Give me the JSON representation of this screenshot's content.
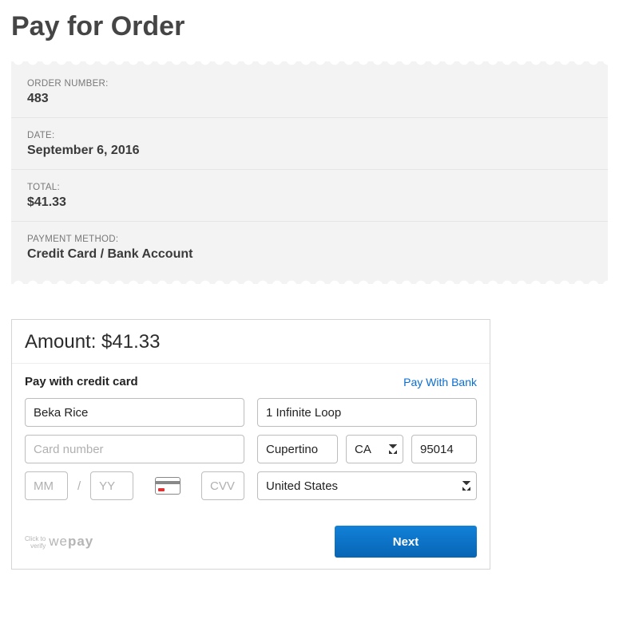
{
  "page_title": "Pay for Order",
  "summary": {
    "order_number_label": "ORDER NUMBER:",
    "order_number": "483",
    "date_label": "DATE:",
    "date": "September 6, 2016",
    "total_label": "TOTAL:",
    "total": "$41.33",
    "payment_method_label": "PAYMENT METHOD:",
    "payment_method": "Credit Card / Bank Account"
  },
  "payment": {
    "amount_label": "Amount: $41.33",
    "section_title": "Pay with credit card",
    "bank_link": "Pay With Bank",
    "name_value": "Beka Rice",
    "card_placeholder": "Card number",
    "mm_placeholder": "MM",
    "yy_placeholder": "YY",
    "cvv_placeholder": "CVV",
    "slash": "/",
    "address_value": "1 Infinite Loop",
    "city_value": "Cupertino",
    "state_value": "CA",
    "zip_value": "95014",
    "country_value": "United States",
    "verify_small_line": "Click to\nverify",
    "verify_small_l1": "Click to",
    "verify_small_l2": "verify",
    "verify_brand_light": "we",
    "verify_brand_bold": "pay",
    "next_label": "Next"
  }
}
